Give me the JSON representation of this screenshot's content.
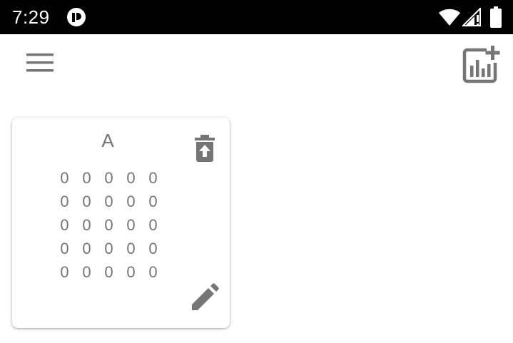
{
  "status_bar": {
    "time": "7:29",
    "icons": [
      "app-notification-icon",
      "wifi-icon",
      "cellular-signal-icon",
      "battery-icon"
    ]
  },
  "toolbar": {
    "menu_icon": "menu-icon",
    "add_icon": "add-chart-icon"
  },
  "card": {
    "title": "A",
    "delete_icon": "delete-icon",
    "edit_icon": "edit-pencil-icon",
    "rows": [
      [
        "0",
        "0",
        "0",
        "0",
        "0"
      ],
      [
        "0",
        "0",
        "0",
        "0",
        "0"
      ],
      [
        "0",
        "0",
        "0",
        "0",
        "0"
      ],
      [
        "0",
        "0",
        "0",
        "0",
        "0"
      ],
      [
        "0",
        "0",
        "0",
        "0",
        "0"
      ]
    ]
  },
  "colors": {
    "status_bar_bg": "#000000",
    "icon_gray": "#757575",
    "text_gray": "#757575",
    "background": "#ffffff"
  }
}
